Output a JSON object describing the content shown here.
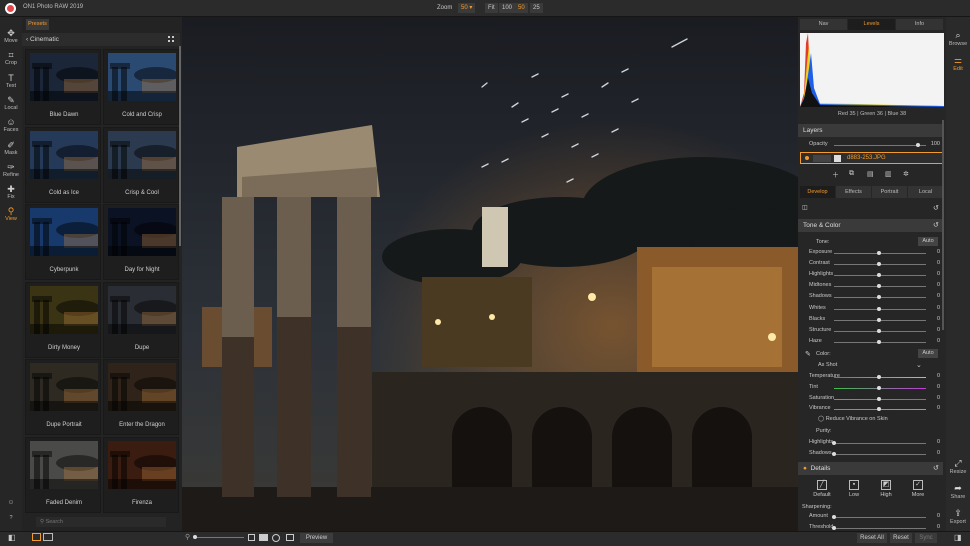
{
  "app": {
    "title": "ON1 Photo RAW 2019"
  },
  "zoom": {
    "label": "Zoom",
    "current": "50",
    "options": [
      "Fit",
      "100",
      "50",
      "25"
    ]
  },
  "left_tools": [
    {
      "label": "Move",
      "icon": "move-icon"
    },
    {
      "label": "Crop",
      "icon": "crop-icon"
    },
    {
      "label": "Text",
      "icon": "text-icon"
    },
    {
      "label": "Local",
      "icon": "local-brush-icon"
    },
    {
      "label": "Faces",
      "icon": "faces-icon"
    },
    {
      "label": "Mask",
      "icon": "mask-icon"
    },
    {
      "label": "Refine",
      "icon": "refine-icon"
    },
    {
      "label": "Fix",
      "icon": "fix-icon"
    },
    {
      "label": "View",
      "icon": "view-zoom-icon",
      "active": true
    }
  ],
  "presets": {
    "tab": "Presets",
    "category": "Cinematic",
    "items": [
      {
        "name": "Blue Dawn",
        "tint": "#1b2638"
      },
      {
        "name": "Cold and Crisp",
        "tint": "#2a4a72"
      },
      {
        "name": "Cold as Ice",
        "tint": "#243a58"
      },
      {
        "name": "Crisp & Cool",
        "tint": "#2b3a4e"
      },
      {
        "name": "Cyberpunk",
        "tint": "#17396b"
      },
      {
        "name": "Day for Night",
        "tint": "#0b1224"
      },
      {
        "name": "Dirty Money",
        "tint": "#3a3414"
      },
      {
        "name": "Dupe",
        "tint": "#2a2e34"
      },
      {
        "name": "Dupe Portrait",
        "tint": "#2e2a22"
      },
      {
        "name": "Enter the Dragon",
        "tint": "#30241a"
      },
      {
        "name": "Faded Denim",
        "tint": "#4a4a48"
      },
      {
        "name": "Firenza",
        "tint": "#3a1c10"
      }
    ],
    "search_placeholder": "Search"
  },
  "bottom": {
    "preview": "Preview",
    "reset_all": "Reset All",
    "reset": "Reset",
    "sync": "Sync"
  },
  "right_tabs": [
    "Nav",
    "Levels",
    "Info"
  ],
  "histogram": {
    "readout": "Red  35  | Green  36  | Blue  38"
  },
  "layers": {
    "title": "Layers",
    "opacity_label": "Opacity",
    "opacity_value": "100",
    "layer_name": "d883-253.JPG"
  },
  "section_tabs": [
    "Develop",
    "Effects",
    "Portrait",
    "Local"
  ],
  "tone_color": {
    "title": "Tone & Color",
    "tone_label": "Tone:",
    "auto": "Auto",
    "sliders": [
      {
        "label": "Exposure",
        "value": "0",
        "pos": 0.5
      },
      {
        "label": "Contrast",
        "value": "0",
        "pos": 0.5
      },
      {
        "label": "Highlights",
        "value": "0",
        "pos": 0.5
      },
      {
        "label": "Midtones",
        "value": "0",
        "pos": 0.5
      },
      {
        "label": "Shadows",
        "value": "0",
        "pos": 0.5
      },
      {
        "label": "Whites",
        "value": "0",
        "pos": 0.5
      },
      {
        "label": "Blacks",
        "value": "0",
        "pos": 0.5
      },
      {
        "label": "Structure",
        "value": "0",
        "pos": 0.5
      },
      {
        "label": "Haze",
        "value": "0",
        "pos": 0.5
      }
    ],
    "color_label": "Color:",
    "white_balance": "As Shot",
    "color_sliders": [
      {
        "label": "Temperature",
        "value": "0",
        "pos": 0.5
      },
      {
        "label": "Tint",
        "value": "0",
        "pos": 0.5
      },
      {
        "label": "Saturation",
        "value": "0",
        "pos": 0.5
      },
      {
        "label": "Vibrance",
        "value": "0",
        "pos": 0.5
      }
    ],
    "reduce_vibrance": "Reduce Vibrance on Skin",
    "purity_label": "Purity:",
    "purity_sliders": [
      {
        "label": "Highlights",
        "value": "0",
        "pos": 0.0
      },
      {
        "label": "Shadows",
        "value": "0",
        "pos": 0.0
      }
    ]
  },
  "details": {
    "title": "Details",
    "presets": [
      "Default",
      "Low",
      "High",
      "More"
    ],
    "sharpening_label": "Sharpening:",
    "sharpen_sliders": [
      {
        "label": "Amount",
        "value": "0"
      },
      {
        "label": "Threshold",
        "value": "0"
      }
    ]
  },
  "right_modules": [
    {
      "label": "Browse",
      "icon": "browse-icon"
    },
    {
      "label": "Edit",
      "icon": "edit-sliders-icon",
      "active": true
    },
    {
      "label": "Resize",
      "icon": "resize-icon"
    },
    {
      "label": "Share",
      "icon": "share-icon"
    },
    {
      "label": "Export",
      "icon": "export-icon"
    }
  ],
  "colors": {
    "accent": "#f39b2d",
    "panel": "#262626",
    "canvas": "#121315"
  }
}
